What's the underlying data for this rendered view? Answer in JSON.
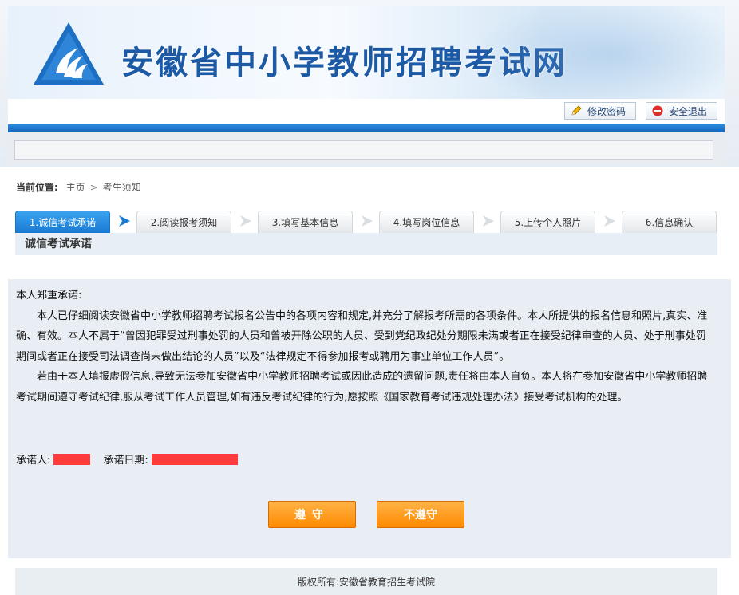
{
  "header": {
    "site_title": "安徽省中小学教师招聘考试网",
    "change_password": "修改密码",
    "logout": "安全退出"
  },
  "breadcrumb": {
    "label": "当前位置:",
    "home": "主页",
    "separator": ">",
    "current": "考生须知"
  },
  "steps": [
    {
      "label": "1.诚信考试承诺",
      "active": true
    },
    {
      "label": "2.阅读报考须知",
      "active": false
    },
    {
      "label": "3.填写基本信息",
      "active": false
    },
    {
      "label": "4.填写岗位信息",
      "active": false
    },
    {
      "label": "5.上传个人照片",
      "active": false
    },
    {
      "label": "6.信息确认",
      "active": false
    }
  ],
  "section": {
    "title": "诚信考试承诺"
  },
  "pledge": {
    "intro": "本人郑重承诺:",
    "paragraph1": "本人已仔细阅读安徽省中小学教师招聘考试报名公告中的各项内容和规定,并充分了解报考所需的各项条件。本人所提供的报名信息和照片,真实、准确、有效。本人不属于“曾因犯罪受过刑事处罚的人员和曾被开除公职的人员、受到党纪政纪处分期限未满或者正在接受纪律审查的人员、处于刑事处罚期间或者正在接受司法调查尚未做出结论的人员”以及“法律规定不得参加报考或聘用为事业单位工作人员”。",
    "paragraph2": "若由于本人填报虚假信息,导致无法参加安徽省中小学教师招聘考试或因此造成的遗留问题,责任将由本人自负。本人将在参加安徽省中小学教师招聘考试期间遵守考试纪律,服从考试工作人员管理,如有违反考试纪律的行为,愿按照《国家教育考试违规处理办法》接受考试机构的处理。",
    "signer_label": "承诺人:",
    "date_label": "承诺日期:"
  },
  "buttons": {
    "agree": "遵守",
    "disagree": "不遵守"
  },
  "footer": {
    "copyright": "版权所有:安徽省教育招生考试院"
  },
  "colors": {
    "brand_blue": "#1c5aa6",
    "active_step": "#1a79d2",
    "button_orange": "#ff8a00",
    "redaction": "#ff3b3b"
  }
}
